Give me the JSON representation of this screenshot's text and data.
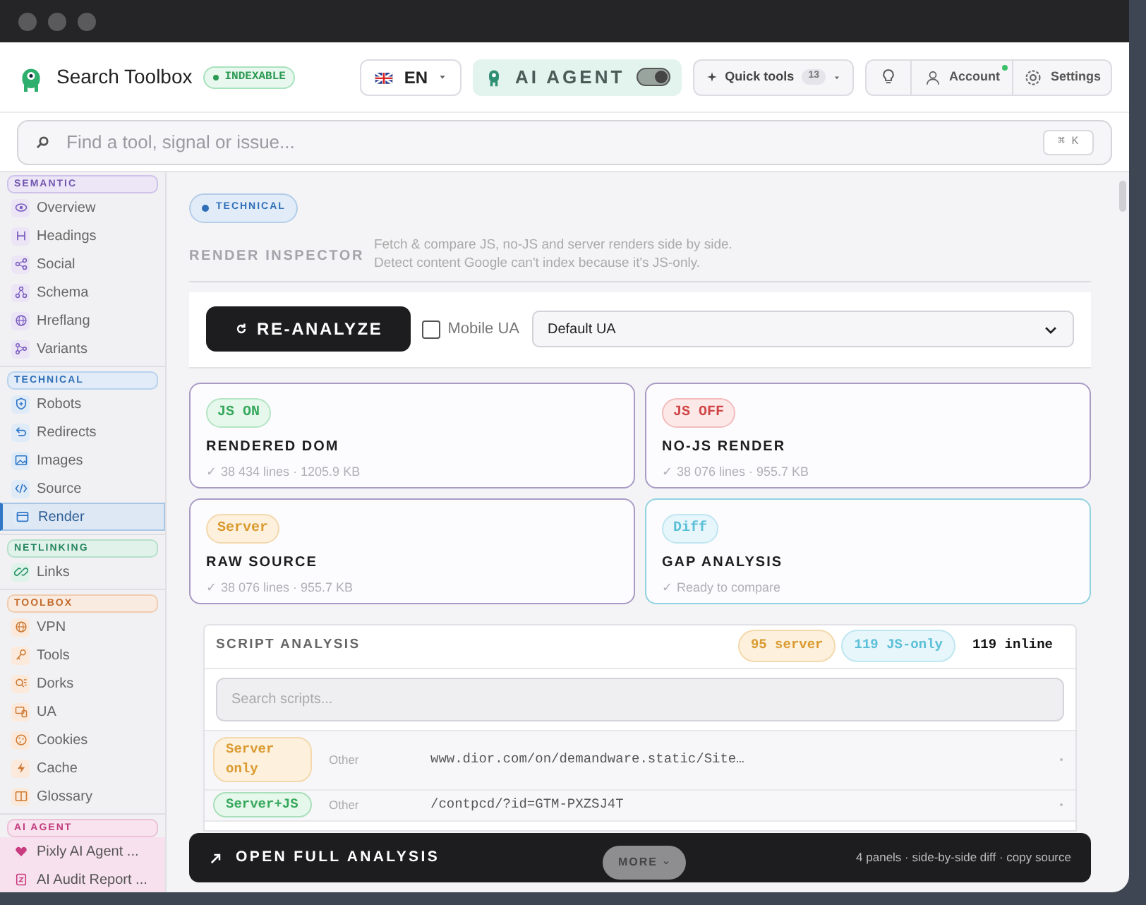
{
  "header": {
    "app_name": "Search Toolbox",
    "status_badge": "INDEXABLE",
    "language": "EN",
    "ai_agent": {
      "label": "AI AGENT",
      "on": true
    },
    "quick_tools": {
      "label": "Quick tools",
      "count": "13"
    },
    "account": {
      "label": "Account",
      "online": true
    },
    "settings": "Settings"
  },
  "search": {
    "placeholder": "Find a tool, signal or issue...",
    "shortcut": "⌘ K"
  },
  "sidebar": {
    "groups": [
      {
        "label": "SEMANTIC",
        "kind": "semantic",
        "items": [
          {
            "label": "Overview",
            "selected": false
          },
          {
            "label": "Headings",
            "selected": false
          },
          {
            "label": "Social",
            "selected": false
          },
          {
            "label": "Schema",
            "selected": false
          },
          {
            "label": "Hreflang",
            "selected": false
          },
          {
            "label": "Variants",
            "selected": false
          }
        ]
      },
      {
        "label": "TECHNICAL",
        "kind": "technical",
        "items": [
          {
            "label": "Robots",
            "selected": false
          },
          {
            "label": "Redirects",
            "selected": false
          },
          {
            "label": "Images",
            "selected": false
          },
          {
            "label": "Source",
            "selected": false
          },
          {
            "label": "Render",
            "selected": true
          }
        ]
      },
      {
        "label": "NETLINKING",
        "kind": "netlinking",
        "items": [
          {
            "label": "Links",
            "selected": false
          }
        ]
      },
      {
        "label": "TOOLBOX",
        "kind": "toolbox",
        "items": [
          {
            "label": "VPN",
            "selected": false
          },
          {
            "label": "Tools",
            "selected": false
          },
          {
            "label": "Dorks",
            "selected": false
          },
          {
            "label": "UA",
            "selected": false
          },
          {
            "label": "Cookies",
            "selected": false
          },
          {
            "label": "Cache",
            "selected": false
          },
          {
            "label": "Glossary",
            "selected": false
          }
        ]
      },
      {
        "label": "AI AGENT",
        "kind": "ai",
        "items": [
          {
            "label": "Pixly AI Agent ...",
            "selected": false
          },
          {
            "label": "AI Audit Report ...",
            "selected": false
          }
        ]
      }
    ]
  },
  "main": {
    "section_tag": "TECHNICAL",
    "title": "RENDER INSPECTOR",
    "description_lines": [
      "Fetch & compare JS, no-JS and server renders side by side.",
      "Detect content Google can't index because it's JS-only."
    ],
    "toolbar": {
      "reanalyze": "RE-ANALYZE",
      "mobile_ua": {
        "label": "Mobile UA",
        "checked": false
      },
      "user_agent": "Default UA"
    },
    "cards": [
      {
        "kind": "js_on",
        "badge": "JS ON",
        "title": "RENDERED DOM",
        "meta": "✓ 38 434 lines · 1205.9 KB"
      },
      {
        "kind": "js_off",
        "badge": "JS OFF",
        "title": "NO-JS RENDER",
        "meta": "✓ 38 076 lines · 955.7 KB"
      },
      {
        "kind": "server",
        "badge": "Server",
        "title": "RAW SOURCE",
        "meta": "✓ 38 076 lines · 955.7 KB"
      },
      {
        "kind": "diff",
        "badge": "Diff",
        "title": "GAP ANALYSIS",
        "meta": "✓ Ready to compare"
      }
    ],
    "script_analysis": {
      "title": "SCRIPT ANALYSIS",
      "counts": [
        {
          "kind": "server",
          "label": "95 server"
        },
        {
          "kind": "js",
          "label": "119 JS-only"
        },
        {
          "kind": "inline",
          "label": "119 inline"
        }
      ],
      "search_placeholder": "Search scripts...",
      "rows": [
        {
          "kind": "server",
          "status": "Server only",
          "type": "Other",
          "url": "www.dior.com/on/demandware.static/Site…"
        },
        {
          "kind": "both",
          "status": "Server+JS",
          "type": "Other",
          "url": "/contpcd/?id=GTM-PXZSJ4T"
        }
      ]
    },
    "footer_bar": {
      "label": "OPEN FULL ANALYSIS",
      "info": "4 panels · side-by-side diff · copy source",
      "more": "MORE"
    }
  }
}
